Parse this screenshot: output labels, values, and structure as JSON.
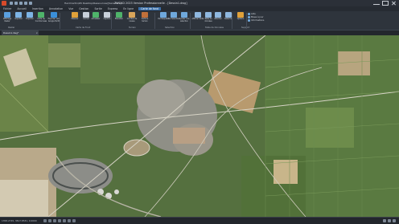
{
  "window": {
    "file_path": "Herzmartin\\Z0 Desktop/Ressources/[Sans titre]",
    "app_title": "ZWCAD 2023 Version Professionnelle - [Dessin1.dwg]"
  },
  "menu_tabs": [
    {
      "label": "Fichier",
      "active": false
    },
    {
      "label": "Accueil",
      "active": false
    },
    {
      "label": "Insertion",
      "active": false
    },
    {
      "label": "Annotation",
      "active": false
    },
    {
      "label": "Vue",
      "active": false
    },
    {
      "label": "Gestion",
      "active": false
    },
    {
      "label": "Sortie",
      "active": false
    },
    {
      "label": "Express",
      "active": false
    },
    {
      "label": "En ligne",
      "active": false
    },
    {
      "label": "Carte de fond",
      "active": true
    }
  ],
  "ribbon": {
    "tools": [
      {
        "label": "Affichage Raster",
        "icon": "raster-icon",
        "color": "#5aa0e0"
      },
      {
        "label": "Importer",
        "icon": "import-icon",
        "color": "#7db4e6"
      },
      {
        "label": "Exporter",
        "icon": "export-icon",
        "color": "#7db4e6"
      },
      {
        "label": "Carte de Coordonnées",
        "icon": "coordinate-map-icon",
        "color": "#4fb36a"
      },
      {
        "label": "Exporter vers Google Earth",
        "icon": "google-earth-icon",
        "color": "#3a8fd9"
      },
      {
        "label": "Mesurer",
        "icon": "measure-icon",
        "color": "#e0a13a"
      },
      {
        "label": "Cacher",
        "icon": "hide-icon",
        "color": "#c8d0da"
      },
      {
        "label": "Actualiser",
        "icon": "refresh-icon",
        "color": "#4fb36a"
      },
      {
        "label": "Capture",
        "icon": "capture-icon",
        "color": "#c8d0da"
      },
      {
        "label": "Elévation",
        "icon": "elevation-icon",
        "color": "#4fb36a"
      },
      {
        "label": "Courbes de niveau",
        "icon": "contour-icon",
        "color": "#d9a55a"
      },
      {
        "label": "Surface terrain",
        "icon": "terrain-icon",
        "color": "#c0703a"
      },
      {
        "label": "Par Requête",
        "icon": "query-icon",
        "color": "#6fa8dc"
      },
      {
        "label": "Par Sélection",
        "icon": "select-icon",
        "color": "#6fa8dc"
      },
      {
        "label": "Ajouter une sélection",
        "icon": "add-selection-icon",
        "color": "#6fa8dc"
      },
      {
        "label": "Afficher Grille",
        "icon": "grid-icon",
        "color": "#8fb8e0"
      },
      {
        "label": "Table de données",
        "icon": "table-icon",
        "color": "#8fb8e0"
      },
      {
        "label": "Attacher",
        "icon": "attach-icon",
        "color": "#8fb8e0"
      },
      {
        "label": "Détacher",
        "icon": "detach-icon",
        "color": "#8fb8e0"
      },
      {
        "label": "Options",
        "icon": "options-icon",
        "color": "#e0a13a"
      }
    ],
    "groups": [
      {
        "label": "Raster"
      },
      {
        "label": "Carte de Fond"
      },
      {
        "label": "Terrain"
      },
      {
        "label": "Sélection"
      },
      {
        "label": "Table de Données"
      },
      {
        "label": "Support"
      }
    ],
    "help_items": [
      "Aide",
      "Mises à jour",
      "Informations"
    ]
  },
  "doc_tab": {
    "label": "Dessin1.dwg*",
    "close": "×"
  },
  "map": {
    "background": "#4f6d3d"
  },
  "status": {
    "coords": "1358.2745, 3817.8531, 0.0000",
    "colors": {
      "bar": "#22262c"
    }
  }
}
